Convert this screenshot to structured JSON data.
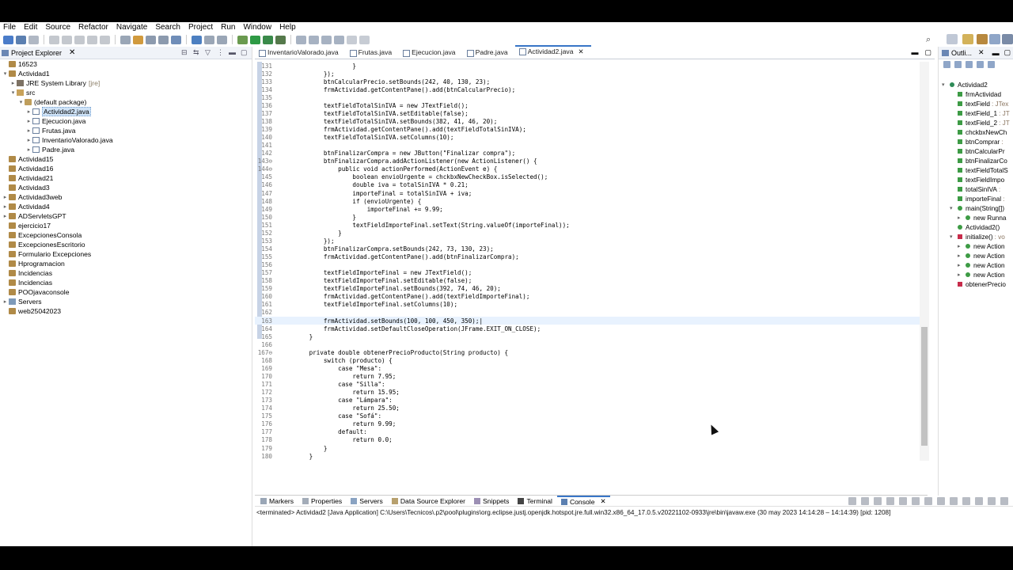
{
  "menu": [
    "File",
    "Edit",
    "Source",
    "Refactor",
    "Navigate",
    "Search",
    "Project",
    "Run",
    "Window",
    "Help"
  ],
  "project_explorer": {
    "title": "Project Explorer",
    "items": [
      {
        "depth": 0,
        "arrow": "",
        "icon": "proj",
        "label": "16523"
      },
      {
        "depth": 0,
        "arrow": "▾",
        "icon": "proj",
        "label": "Actividad1"
      },
      {
        "depth": 1,
        "arrow": "▸",
        "icon": "lib",
        "label": "JRE System Library",
        "suffix": "[jre]"
      },
      {
        "depth": 1,
        "arrow": "▾",
        "icon": "src",
        "label": "src"
      },
      {
        "depth": 2,
        "arrow": "▾",
        "icon": "pkg",
        "label": "(default package)"
      },
      {
        "depth": 3,
        "arrow": "▸",
        "icon": "java",
        "label": "Actividad2.java",
        "selected": true
      },
      {
        "depth": 3,
        "arrow": "▸",
        "icon": "java",
        "label": "Ejecucion.java"
      },
      {
        "depth": 3,
        "arrow": "▸",
        "icon": "java",
        "label": "Frutas.java"
      },
      {
        "depth": 3,
        "arrow": "▸",
        "icon": "java",
        "label": "InventarioValorado.java"
      },
      {
        "depth": 3,
        "arrow": "▸",
        "icon": "java",
        "label": "Padre.java"
      },
      {
        "depth": 0,
        "arrow": "",
        "icon": "proj",
        "label": "Actividad15"
      },
      {
        "depth": 0,
        "arrow": "",
        "icon": "proj",
        "label": "Actividad16"
      },
      {
        "depth": 0,
        "arrow": "",
        "icon": "proj",
        "label": "Actividad21"
      },
      {
        "depth": 0,
        "arrow": "",
        "icon": "proj",
        "label": "Actividad3"
      },
      {
        "depth": 0,
        "arrow": "▸",
        "icon": "proj",
        "label": "Actividad3web"
      },
      {
        "depth": 0,
        "arrow": "▸",
        "icon": "proj",
        "label": "Actividad4"
      },
      {
        "depth": 0,
        "arrow": "▸",
        "icon": "proj",
        "label": "ADServletsGPT"
      },
      {
        "depth": 0,
        "arrow": "",
        "icon": "proj",
        "label": "ejercicio17"
      },
      {
        "depth": 0,
        "arrow": "",
        "icon": "proj",
        "label": "ExcepcionesConsola"
      },
      {
        "depth": 0,
        "arrow": "",
        "icon": "proj",
        "label": "ExcepcionesEscritorio"
      },
      {
        "depth": 0,
        "arrow": "",
        "icon": "proj",
        "label": "Formulario Excepciones"
      },
      {
        "depth": 0,
        "arrow": "",
        "icon": "proj",
        "label": "Hprogramacion"
      },
      {
        "depth": 0,
        "arrow": "",
        "icon": "proj",
        "label": "Incidencias"
      },
      {
        "depth": 0,
        "arrow": "",
        "icon": "proj",
        "label": "Incidencias"
      },
      {
        "depth": 0,
        "arrow": "",
        "icon": "proj",
        "label": "POOjavaconsole"
      },
      {
        "depth": 0,
        "arrow": "▸",
        "icon": "srv",
        "label": "Servers"
      },
      {
        "depth": 0,
        "arrow": "",
        "icon": "proj",
        "label": "web25042023"
      }
    ]
  },
  "editor": {
    "tabs": [
      {
        "label": "InventarioValorado.java"
      },
      {
        "label": "Frutas.java"
      },
      {
        "label": "Ejecucion.java"
      },
      {
        "label": "Padre.java"
      },
      {
        "label": "Actividad2.java",
        "active": true
      }
    ],
    "lines": [
      {
        "n": "131",
        "t": "                    }"
      },
      {
        "n": "132",
        "t": "            });"
      },
      {
        "n": "133",
        "t": "            btnCalcularPrecio.setBounds(242, 40, 130, 23);"
      },
      {
        "n": "134",
        "t": "            frmActividad.getContentPane().add(btnCalcularPrecio);"
      },
      {
        "n": "135",
        "t": ""
      },
      {
        "n": "136",
        "t": "            textFieldTotalSinIVA = new JTextField();"
      },
      {
        "n": "137",
        "t": "            textFieldTotalSinIVA.setEditable(false);"
      },
      {
        "n": "138",
        "t": "            textFieldTotalSinIVA.setBounds(382, 41, 46, 20);"
      },
      {
        "n": "139",
        "t": "            frmActividad.getContentPane().add(textFieldTotalSinIVA);"
      },
      {
        "n": "140",
        "t": "            textFieldTotalSinIVA.setColumns(10);"
      },
      {
        "n": "141",
        "t": ""
      },
      {
        "n": "142",
        "t": "            btnFinalizarCompra = new JButton(\"Finalizar compra\");"
      },
      {
        "n": "143⊖",
        "t": "            btnFinalizarCompra.addActionListener(new ActionListener() {"
      },
      {
        "n": "144⊖",
        "t": "                public void actionPerformed(ActionEvent e) {"
      },
      {
        "n": "145",
        "t": "                    boolean envioUrgente = chckbxNewCheckBox.isSelected();"
      },
      {
        "n": "146",
        "t": "                    double iva = totalSinIVA * 0.21;"
      },
      {
        "n": "147",
        "t": "                    importeFinal = totalSinIVA + iva;"
      },
      {
        "n": "148",
        "t": "                    if (envioUrgente) {"
      },
      {
        "n": "149",
        "t": "                        importeFinal += 9.99;"
      },
      {
        "n": "150",
        "t": "                    }"
      },
      {
        "n": "151",
        "t": "                    textFieldImporteFinal.setText(String.valueOf(importeFinal));"
      },
      {
        "n": "152",
        "t": "                }"
      },
      {
        "n": "153",
        "t": "            });"
      },
      {
        "n": "154",
        "t": "            btnFinalizarCompra.setBounds(242, 73, 130, 23);"
      },
      {
        "n": "155",
        "t": "            frmActividad.getContentPane().add(btnFinalizarCompra);"
      },
      {
        "n": "156",
        "t": ""
      },
      {
        "n": "157",
        "t": "            textFieldImporteFinal = new JTextField();"
      },
      {
        "n": "158",
        "t": "            textFieldImporteFinal.setEditable(false);"
      },
      {
        "n": "159",
        "t": "            textFieldImporteFinal.setBounds(392, 74, 46, 20);"
      },
      {
        "n": "160",
        "t": "            frmActividad.getContentPane().add(textFieldImporteFinal);"
      },
      {
        "n": "161",
        "t": "            textFieldImporteFinal.setColumns(10);"
      },
      {
        "n": "162",
        "t": ""
      },
      {
        "n": "163",
        "t": "            frmActividad.setBounds(100, 100, 450, 350);|",
        "current": true
      },
      {
        "n": "164",
        "t": "            frmActividad.setDefaultCloseOperation(JFrame.EXIT_ON_CLOSE);"
      },
      {
        "n": "165",
        "t": "        }"
      },
      {
        "n": "166",
        "t": ""
      },
      {
        "n": "167⊖",
        "t": "        private double obtenerPrecioProducto(String producto) {"
      },
      {
        "n": "168",
        "t": "            switch (producto) {"
      },
      {
        "n": "169",
        "t": "                case \"Mesa\":"
      },
      {
        "n": "170",
        "t": "                    return 7.95;"
      },
      {
        "n": "171",
        "t": "                case \"Silla\":"
      },
      {
        "n": "172",
        "t": "                    return 15.95;"
      },
      {
        "n": "173",
        "t": "                case \"Lámpara\":"
      },
      {
        "n": "174",
        "t": "                    return 25.50;"
      },
      {
        "n": "175",
        "t": "                case \"Sofá\":"
      },
      {
        "n": "176",
        "t": "                    return 9.99;"
      },
      {
        "n": "177",
        "t": "                default:"
      },
      {
        "n": "178",
        "t": "                    return 0.0;"
      },
      {
        "n": "179",
        "t": "            }"
      },
      {
        "n": "180",
        "t": "        }"
      },
      {
        "n": "181",
        "t": "    }"
      },
      {
        "n": "182",
        "t": ""
      }
    ],
    "bottom_tabs": [
      {
        "label": "Source",
        "active": true
      },
      {
        "label": "Design"
      }
    ]
  },
  "outline": {
    "title": "Outli...",
    "items": [
      {
        "depth": 0,
        "arrow": "▾",
        "kind": "class",
        "label": "Actividad2"
      },
      {
        "depth": 1,
        "kind": "field",
        "label": "frmActividad"
      },
      {
        "depth": 1,
        "kind": "field",
        "label": "textField",
        "type": ": JTex"
      },
      {
        "depth": 1,
        "kind": "field",
        "label": "textField_1",
        "type": ": JT"
      },
      {
        "depth": 1,
        "kind": "field",
        "label": "textField_2",
        "type": ": JT"
      },
      {
        "depth": 1,
        "kind": "field",
        "label": "chckbxNewCh"
      },
      {
        "depth": 1,
        "kind": "field",
        "label": "btnComprar",
        "type": ":"
      },
      {
        "depth": 1,
        "kind": "field",
        "label": "btnCalcularPr"
      },
      {
        "depth": 1,
        "kind": "field",
        "label": "btnFinalizarCo"
      },
      {
        "depth": 1,
        "kind": "field",
        "label": "textFieldTotalS"
      },
      {
        "depth": 1,
        "kind": "field",
        "label": "textFieldImpo"
      },
      {
        "depth": 1,
        "kind": "field",
        "label": "totalSinIVA",
        "type": ":"
      },
      {
        "depth": 1,
        "kind": "field",
        "label": "importeFinal",
        "type": ":"
      },
      {
        "depth": 1,
        "arrow": "▾",
        "kind": "method",
        "label": "main(String[])"
      },
      {
        "depth": 2,
        "arrow": "▸",
        "kind": "anon",
        "label": "new Runna"
      },
      {
        "depth": 1,
        "kind": "ctor",
        "label": "Actividad2()"
      },
      {
        "depth": 1,
        "arrow": "▾",
        "kind": "private",
        "label": "initialize()",
        "type": ": vo"
      },
      {
        "depth": 2,
        "arrow": "▸",
        "kind": "anon",
        "label": "new Action"
      },
      {
        "depth": 2,
        "arrow": "▸",
        "kind": "anon",
        "label": "new Action"
      },
      {
        "depth": 2,
        "arrow": "▸",
        "kind": "anon",
        "label": "new Action"
      },
      {
        "depth": 2,
        "arrow": "▸",
        "kind": "anon",
        "label": "new Action"
      },
      {
        "depth": 1,
        "kind": "private",
        "label": "obtenerPrecio"
      }
    ]
  },
  "console": {
    "tabs": [
      {
        "label": "Markers"
      },
      {
        "label": "Properties"
      },
      {
        "label": "Servers"
      },
      {
        "label": "Data Source Explorer"
      },
      {
        "label": "Snippets"
      },
      {
        "label": "Terminal"
      },
      {
        "label": "Console",
        "active": true
      }
    ],
    "line": "<terminated> Actividad2 [Java Application] C:\\Users\\Tecnicos\\.p2\\pool\\plugins\\org.eclipse.justj.openjdk.hotspot.jre.full.win32.x86_64_17.0.5.v20221102-0933\\jre\\bin\\javaw.exe  (30 may 2023 14:14:28 – 14:14:39) [pid: 1208]"
  },
  "colors": {
    "selection": "#cfe3f7",
    "current_line": "#e8f2fe",
    "active_tab_border": "#3875c7",
    "field_icon": "#3d9b45",
    "method_icon": "#3d9b45",
    "private_icon": "#c72c4b"
  }
}
